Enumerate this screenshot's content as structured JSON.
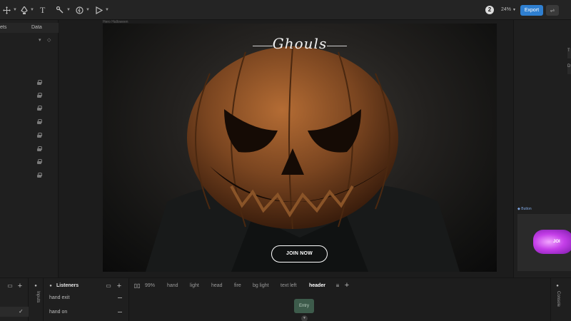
{
  "toolbar": {
    "tools": [
      {
        "icon": "move-icon"
      },
      {
        "icon": "pen-icon"
      },
      {
        "icon": "text-icon"
      },
      {
        "icon": "bone-icon"
      },
      {
        "icon": "constraint-icon"
      },
      {
        "icon": "play-icon"
      }
    ],
    "text_tool_glyph": "T",
    "rive_badge": "2",
    "zoom": "24%",
    "export_label": "Export"
  },
  "left_panel": {
    "tabs": [
      "ets",
      "Data"
    ],
    "lock_rows": 8
  },
  "canvas": {
    "artboard_label": "Hero Halloween",
    "title": "Ghouls",
    "cta": "JOIN NOW"
  },
  "right_panel": {
    "component_label": "Button",
    "thumb_text": "JOI"
  },
  "bottom": {
    "listeners_title": "Listeners",
    "inputs_label": "Inputs",
    "console_label": "Console",
    "listeners": [
      "hand exit",
      "hand on"
    ],
    "zoom": "99%",
    "layers": [
      "hand",
      "light",
      "head",
      "fire",
      "bg light",
      "text left",
      "header"
    ],
    "active_layer": "header",
    "entry_label": "Entry"
  },
  "colors": {
    "accent": "#2f7fd0",
    "entry_node": "#3d5b4b",
    "button_blob": "#c43ee8"
  }
}
